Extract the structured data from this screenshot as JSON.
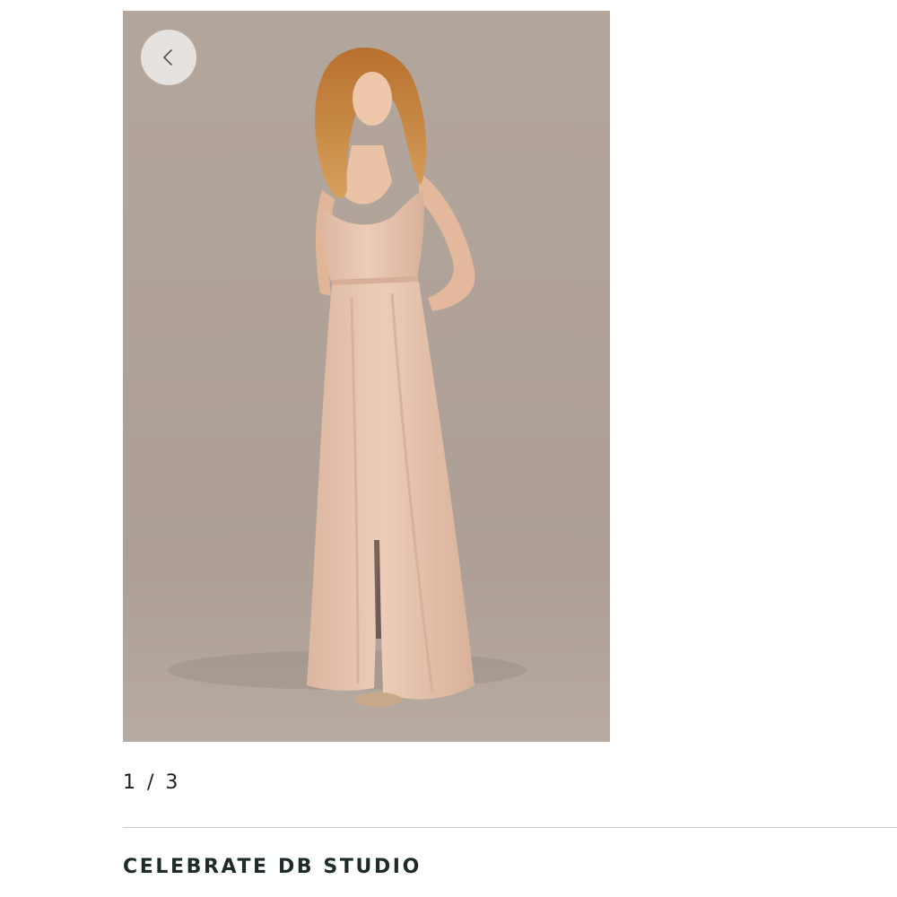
{
  "gallery": {
    "prev_icon": "chevron-left-icon",
    "image_subject": "model-in-blush-maxi-dress",
    "counter": {
      "current": "1",
      "separator": "/",
      "total": "3"
    }
  },
  "product": {
    "brand": "CELEBRATE DB STUDIO"
  },
  "colors": {
    "photo_background": "#b0a39a",
    "dress": "#e7c4ad",
    "brand_text": "#1f2b2a",
    "divider": "#c9c9c9"
  }
}
